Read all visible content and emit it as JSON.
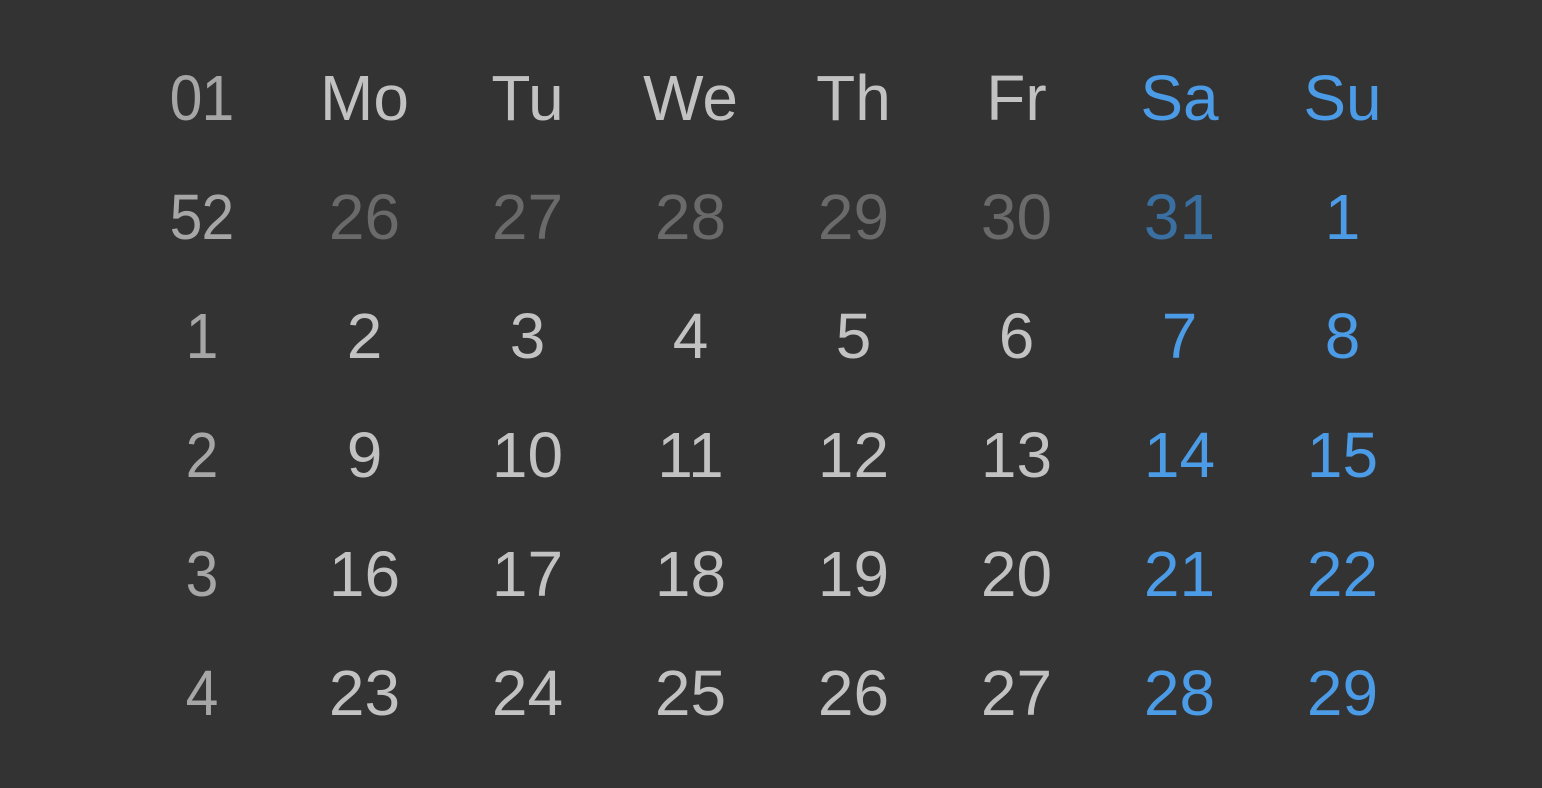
{
  "calendar": {
    "corner_label": "01",
    "weekday_headers": [
      {
        "label": "Mo",
        "weekend": false
      },
      {
        "label": "Tu",
        "weekend": false
      },
      {
        "label": "We",
        "weekend": false
      },
      {
        "label": "Th",
        "weekend": false
      },
      {
        "label": "Fr",
        "weekend": false
      },
      {
        "label": "Sa",
        "weekend": true
      },
      {
        "label": "Su",
        "weekend": true
      }
    ],
    "weeks": [
      {
        "week": "52",
        "days": [
          {
            "day": "26",
            "outside_month": true
          },
          {
            "day": "27",
            "outside_month": true
          },
          {
            "day": "28",
            "outside_month": true
          },
          {
            "day": "29",
            "outside_month": true
          },
          {
            "day": "30",
            "outside_month": true
          },
          {
            "day": "31",
            "outside_month": true
          },
          {
            "day": "1",
            "outside_month": false
          }
        ]
      },
      {
        "week": "1",
        "days": [
          {
            "day": "2",
            "outside_month": false
          },
          {
            "day": "3",
            "outside_month": false
          },
          {
            "day": "4",
            "outside_month": false
          },
          {
            "day": "5",
            "outside_month": false
          },
          {
            "day": "6",
            "outside_month": false
          },
          {
            "day": "7",
            "outside_month": false
          },
          {
            "day": "8",
            "outside_month": false
          }
        ]
      },
      {
        "week": "2",
        "days": [
          {
            "day": "9",
            "outside_month": false
          },
          {
            "day": "10",
            "outside_month": false
          },
          {
            "day": "11",
            "outside_month": false
          },
          {
            "day": "12",
            "outside_month": false
          },
          {
            "day": "13",
            "outside_month": false
          },
          {
            "day": "14",
            "outside_month": false
          },
          {
            "day": "15",
            "outside_month": false
          }
        ]
      },
      {
        "week": "3",
        "days": [
          {
            "day": "16",
            "outside_month": false
          },
          {
            "day": "17",
            "outside_month": false
          },
          {
            "day": "18",
            "outside_month": false
          },
          {
            "day": "19",
            "outside_month": false
          },
          {
            "day": "20",
            "outside_month": false
          },
          {
            "day": "21",
            "outside_month": false
          },
          {
            "day": "22",
            "outside_month": false
          }
        ]
      },
      {
        "week": "4",
        "days": [
          {
            "day": "23",
            "outside_month": false
          },
          {
            "day": "24",
            "outside_month": false
          },
          {
            "day": "25",
            "outside_month": false
          },
          {
            "day": "26",
            "outside_month": false
          },
          {
            "day": "27",
            "outside_month": false
          },
          {
            "day": "28",
            "outside_month": false
          },
          {
            "day": "29",
            "outside_month": false
          }
        ]
      }
    ]
  },
  "colors": {
    "background": "#333333",
    "text": "#c2c2c2",
    "week_number": "#a6a6a6",
    "weekend_accent": "#4b9be6",
    "outside_month_text": "#6a6a6a",
    "outside_month_weekend": "#3a6fa2"
  }
}
